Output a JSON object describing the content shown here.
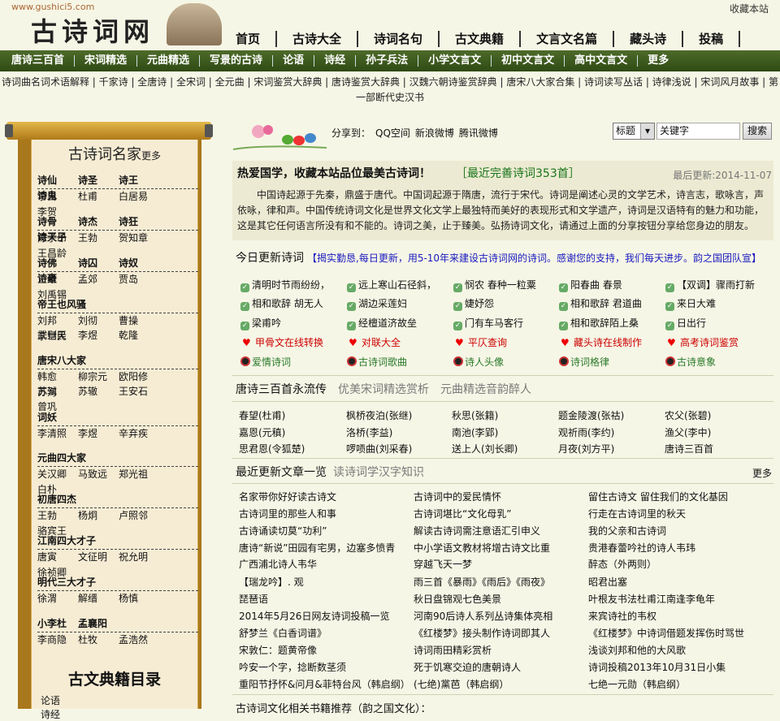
{
  "header": {
    "url": "www.gushici5.com",
    "logo_text": "古诗词网",
    "favorite": "收藏本站",
    "nav": [
      "首页",
      "古诗大全",
      "诗词名句",
      "古文典籍",
      "文言文名篇",
      "藏头诗",
      "投稿"
    ]
  },
  "greenbar": [
    "唐诗三百首",
    "宋词精选",
    "元曲精选",
    "写景的古诗",
    "论语",
    "诗经",
    "孙子兵法",
    "小学文言文",
    "初中文言文",
    "高中文言文",
    "更多"
  ],
  "linkline": "诗词曲名词术语解释 | 千家诗 | 全唐诗 | 全宋词 | 全元曲 | 宋词鉴赏大辞典 | 唐诗鉴赏大辞典 | 汉魏六朝诗鉴赏辞典 | 唐宋八大家合集 | 诗词读写丛话 | 诗律浅说 | 宋词风月故事 | 第一部断代史汉书",
  "sidebar": {
    "title": "古诗词名家",
    "more": "更多",
    "groups": [
      {
        "titles": [
          "诗仙",
          "诗圣",
          "诗王",
          "诗鬼"
        ],
        "poets": [
          "李白",
          "杜甫",
          "白居易",
          "李贺"
        ]
      },
      {
        "titles": [
          "诗骨",
          "诗杰",
          "诗狂",
          "诗天子"
        ],
        "poets": [
          "陈子昂",
          "王勃",
          "贺知章",
          "王昌龄"
        ]
      },
      {
        "titles": [
          "诗佛",
          "诗囚",
          "诗奴",
          "诗豪"
        ],
        "poets": [
          "王维",
          "孟郊",
          "贾岛",
          "刘禹锡"
        ]
      },
      {
        "titles": [
          "帝王也风骚"
        ],
        "poets": [
          "刘邦",
          "刘彻",
          "曹操",
          "李世民",
          "武则天",
          "李煜",
          "乾隆"
        ]
      },
      {
        "titles": [
          "唐宋八大家"
        ],
        "poets": [
          "韩愈",
          "柳宗元",
          "欧阳修",
          "苏洵",
          "苏轼",
          "苏辙",
          "王安石",
          "曾巩"
        ]
      },
      {
        "titles": [
          "词妖"
        ],
        "poets": [
          "李清照",
          "李煜",
          "辛弃疾"
        ]
      },
      {
        "titles": [
          "元曲四大家"
        ],
        "poets": [
          "关汉卿",
          "马致远",
          "郑光祖",
          "白朴"
        ]
      },
      {
        "titles": [
          "初唐四杰"
        ],
        "poets": [
          "王勃",
          "杨炯",
          "卢照邻",
          "骆宾王"
        ]
      },
      {
        "titles": [
          "江南四大才子"
        ],
        "poets": [
          "唐寅",
          "文征明",
          "祝允明",
          "徐祯卿"
        ]
      },
      {
        "titles": [
          "明代三大才子"
        ],
        "poets": [
          "徐渭",
          "解缙",
          "杨慎"
        ]
      },
      {
        "titles": [
          "小李杜",
          "孟襄阳"
        ],
        "poets": [
          "李商隐",
          "杜牧",
          "孟浩然"
        ]
      }
    ],
    "classics_title": "古文典籍目录",
    "classics": [
      "论语",
      "诗经"
    ]
  },
  "share": {
    "label": "分享到：",
    "links": [
      "QQ空间",
      "新浪微博",
      "腾讯微博"
    ]
  },
  "search": {
    "select": "标题",
    "placeholder": "关键字",
    "button": "搜索"
  },
  "intro": {
    "heading": "热爱国学，收藏本站品位最美古诗词！",
    "recent": "［最近完善诗词353首］",
    "date": "最后更新:2014-11-07",
    "text": "中国诗起源于先秦，鼎盛于唐代。中国词起源于隋唐，流行于宋代。诗词是阐述心灵的文学艺术，诗言志，歌咏言，声依咏，律和声。中国传统诗词文化是世界文化文学上最独特而美好的表现形式和文学遗产，诗词是汉语特有的魅力和功能，这是其它任何语言所没有和不能的。诗词之美，止于臻美。弘扬诗词文化，请通过上面的分享按钮分享给您身边的朋友。"
  },
  "today": {
    "title": "今日更新诗词",
    "note": "【揭实勤恳,每日更新，用5-10年来建设古诗词网的诗词。感谢您的支持，我们每天进步。韵之国团队宣】",
    "items": [
      "清明时节雨纷纷，",
      "远上寒山石径斜，",
      "悯农 春种一粒粟",
      "阳春曲 春景",
      "【双调】骤雨打新",
      "相和歌辞 胡无人",
      "湖边采莲妇",
      "婕妤怨",
      "相和歌辞 君道曲",
      "来日大难",
      "梁甫吟",
      "经檀道济故垒",
      "门有车马客行",
      "相和歌辞陌上桑",
      "日出行"
    ],
    "tools": [
      "甲骨文在线转换",
      "对联大全",
      "平仄查询",
      "藏头诗在线制作",
      "高考诗词鉴赏"
    ],
    "tools2": [
      "爱情诗词",
      "古诗词歌曲",
      "诗人头像",
      "诗词格律",
      "古诗意象"
    ]
  },
  "tang": {
    "tabs": [
      "唐诗三百首永流传",
      "优美宋词精选赏析",
      "元曲精选音韵醉人"
    ],
    "poems": [
      "春望(杜甫)",
      "枫桥夜泊(张继)",
      "秋思(张籍)",
      "题金陵渡(张祜)",
      "农父(张碧)",
      "嘉恩(元稹)",
      "洛桥(李益)",
      "南池(李郢)",
      "观祈雨(李约)",
      "渔父(李中)",
      "思君恩(令狐楚)",
      "啰唝曲(刘采春)",
      "送上人(刘长卿)",
      "月夜(刘方平)",
      "唐诗三百首"
    ]
  },
  "news": {
    "tabs": [
      "最近更新文章一览",
      "读诗词学汉字知识"
    ],
    "more": "更多",
    "items": [
      "名家带你好好读古诗文",
      "古诗词中的爱民情怀",
      "留住古诗文 留住我们的文化基因",
      "古诗词里的那些人和事",
      "古诗词堪比“文化母乳”",
      "行走在古诗词里的秋天",
      "古诗诵读切莫“功利”",
      "解读古诗词需注意语汇引申义",
      "我的父亲和古诗词",
      "唐诗“新说”田园有宅男，边塞多愤青",
      "中小学语文教材将增古诗文比重",
      "贵港春蕾吟社的诗人韦玮",
      "广西浦北诗人韦华",
      "穿越飞天一梦",
      "醉态（外两则）",
      "【瑞龙吟】. 观",
      "雨三首《暴雨》《雨后》《雨夜》",
      "昭君出塞",
      "琵琶语",
      "秋日盘锦观七色美景",
      "叶根友书法杜甫江南逢李龟年",
      "2014年5月26日网友诗词投稿一览",
      "河南90后诗人系列丛诗集体亮相",
      "来宾诗社的韦权",
      "舒梦兰《白香词谱》",
      "《红楼梦》接头制作诗词即其人",
      "《红楼梦》中诗词借题发挥伤时骂世",
      "宋敦仁：题黄帝像",
      "诗词雨田精彩赏析",
      "浅谈刘邦和他的大风歌",
      "吟安一个字，捻断数茎须",
      "死于饥寒交迫的唐朝诗人",
      "诗词投稿2013年10月31日小集",
      "重阳节抒怀&问月&菲特台风（韩启纲）",
      "(七绝)黨芭（韩启纲）",
      "七绝一元勋（韩启纲）"
    ]
  },
  "bottom": "古诗词文化相关书籍推荐（韵之国文化）："
}
